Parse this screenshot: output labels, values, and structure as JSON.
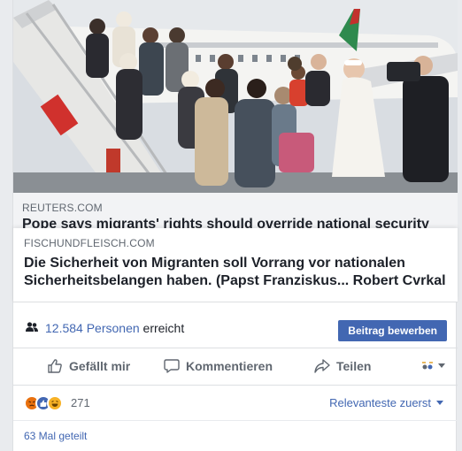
{
  "shared_link": {
    "photo_alt": "",
    "original_domain": "REUTERS.COM",
    "original_title": "Pope says migrants' rights should override national security"
  },
  "link_card": {
    "domain": "FISCHUNDFLEISCH.COM",
    "title": "Die Sicherheit von Migranten soll Vorrang vor nationalen Sicherheitsbelangen haben. (Papst Franziskus... Robert Cvrkal"
  },
  "reach": {
    "count_label": "12.584 Personen",
    "suffix": " erreicht",
    "boost_label": "Beitrag bewerben"
  },
  "actions": {
    "like_label": "Gefällt mir",
    "comment_label": "Kommentieren",
    "share_label": "Teilen",
    "audience_icon": "audience-switch-icon"
  },
  "reactions": {
    "types": [
      "angry",
      "like",
      "haha"
    ],
    "count": "271",
    "sort_label": "Relevanteste zuerst"
  },
  "shares": {
    "label": "63 Mal geteilt"
  },
  "colors": {
    "accent": "#4267b2",
    "muted_text": "#606770",
    "angry": "#e9710f",
    "haha": "#f7b125"
  }
}
